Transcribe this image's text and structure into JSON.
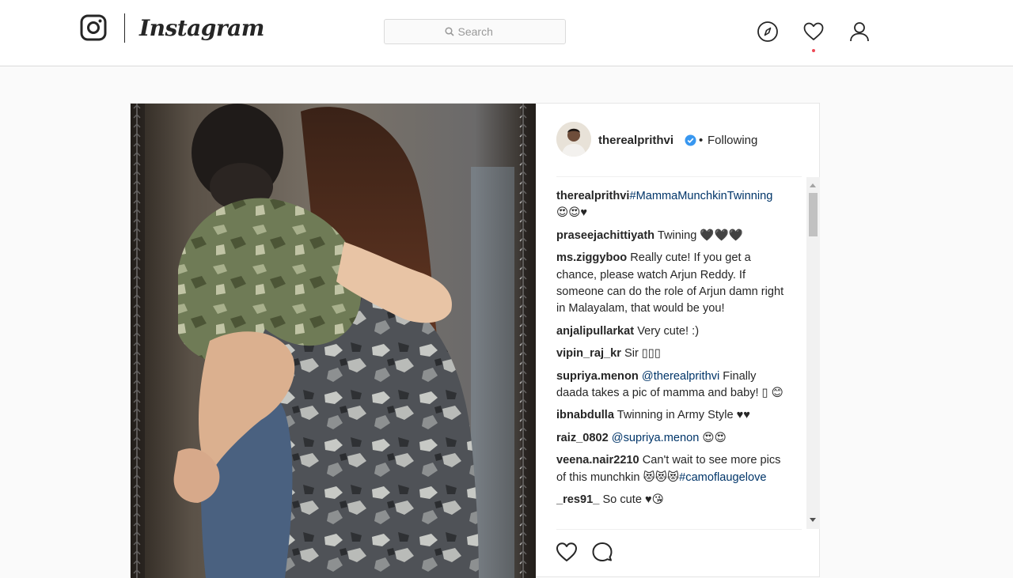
{
  "header": {
    "brand": "Instagram",
    "search_placeholder": "Search",
    "icons": [
      "instagram-glyph-icon",
      "search-icon",
      "compass-icon",
      "heart-icon",
      "profile-icon"
    ]
  },
  "post": {
    "author": "therealprithvi",
    "verified": true,
    "separator": "•",
    "follow_status": "Following",
    "comments": [
      {
        "user": "therealprithvi",
        "text": "",
        "link": "#MammaMunchkinTwinning",
        "suffix": " 😍😍♥"
      },
      {
        "user": "praseejachittiyath",
        "text": " Twining 🖤🖤🖤",
        "link": "",
        "suffix": ""
      },
      {
        "user": "ms.ziggyboo",
        "text": " Really cute! If you get a chance, please watch Arjun Reddy. If someone can do the role of Arjun damn right in Malayalam, that would be you!",
        "link": "",
        "suffix": ""
      },
      {
        "user": "anjalipullarkat",
        "text": " Very cute! :)",
        "link": "",
        "suffix": ""
      },
      {
        "user": "vipin_raj_kr",
        "text": " Sir ▯▯▯",
        "link": "",
        "suffix": ""
      },
      {
        "user": "supriya.menon",
        "text": " ",
        "link": "@therealprithvi",
        "suffix": " Finally daada takes a pic of mamma and baby! ▯ 😊"
      },
      {
        "user": "ibnabdulla",
        "text": " Twinning in Army Style ♥♥",
        "link": "",
        "suffix": ""
      },
      {
        "user": "raiz_0802",
        "text": " ",
        "link": "@supriya.menon",
        "suffix": " 😍😍"
      },
      {
        "user": "veena.nair2210",
        "text": " Can't wait to see more pics of this munchkin 😻😻😻",
        "link": "#camoflaugelove",
        "suffix": ""
      },
      {
        "user": "_res91_",
        "text": "  So cute ♥😘",
        "link": "",
        "suffix": ""
      }
    ],
    "actions": [
      "like-heart-icon",
      "comment-bubble-icon"
    ]
  },
  "colors": {
    "background": "#fafafa",
    "card": "#ffffff",
    "border": "#dbdbdb",
    "text": "#262626",
    "link": "#003569",
    "verified": "#3897f0",
    "notification": "#ed4956"
  }
}
